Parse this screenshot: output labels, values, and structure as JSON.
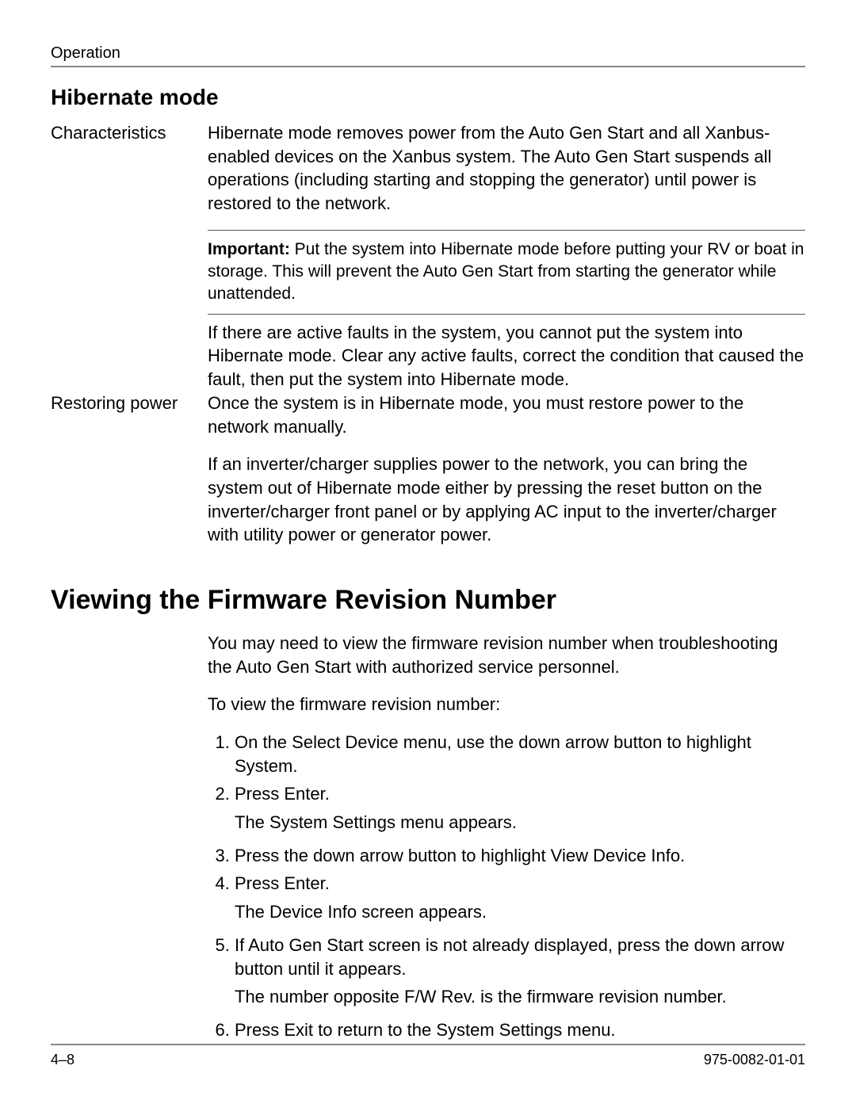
{
  "running_head": "Operation",
  "section_heading": "Hibernate mode",
  "rows": [
    {
      "side": "Characteristics",
      "paras": [
        "Hibernate mode removes power from the Auto Gen Start and all Xanbus-enabled devices on the Xanbus system. The Auto Gen Start suspends all operations (including starting and stopping the generator) until power is restored to the network."
      ]
    }
  ],
  "callout": {
    "lead": "Important:",
    "text": " Put the system into Hibernate mode before putting your RV or boat in storage. This will prevent the Auto Gen Start from starting the generator while unattended."
  },
  "after_callout_para": "If there are active faults in the system, you cannot put the system into Hibernate mode. Clear any active faults, correct the condition that caused the fault, then put the system into Hibernate mode.",
  "row2": {
    "side": "Restoring power",
    "paras": [
      "Once the system is in Hibernate mode, you must restore power to the network manually.",
      "If an inverter/charger supplies power to the network, you can bring the system out of Hibernate mode either by pressing the reset button on the inverter/charger front panel or by applying AC input to the inverter/charger with utility power or generator power."
    ]
  },
  "h1": "Viewing the Firmware Revision Number",
  "intro_paras": [
    "You may need to view the firmware revision number when troubleshooting the Auto Gen Start with authorized service personnel.",
    "To view the firmware revision number:"
  ],
  "steps": [
    {
      "text": "On the Select Device menu, use the down arrow button to highlight System."
    },
    {
      "text": "Press Enter.",
      "sub": "The System Settings menu appears."
    },
    {
      "text": "Press the down arrow button to highlight View Device Info."
    },
    {
      "text": "Press Enter.",
      "sub": "The Device Info screen appears."
    },
    {
      "text": "If Auto Gen Start screen is not already displayed, press the down arrow button until it appears.",
      "sub": "The number opposite  F/W Rev.  is the firmware revision number."
    },
    {
      "text": "Press Exit to return to the System Settings menu."
    }
  ],
  "footer": {
    "left": "4–8",
    "right": "975-0082-01-01"
  }
}
